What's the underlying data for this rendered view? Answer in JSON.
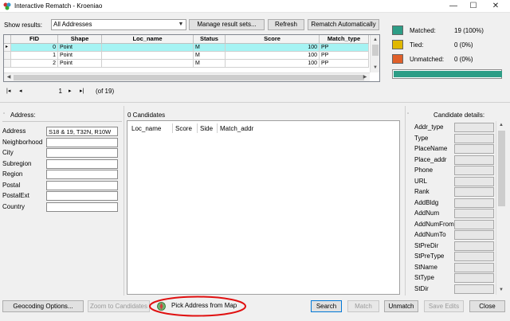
{
  "window": {
    "title": "Interactive Rematch - Kroeniao",
    "minimize": "—",
    "maximize": "☐",
    "close": "✕"
  },
  "toolbar": {
    "show_results_label": "Show results:",
    "show_results_value": "All Addresses",
    "manage_label": "Manage result sets...",
    "refresh_label": "Refresh",
    "rematch_auto_label": "Rematch Automatically"
  },
  "grid": {
    "columns": [
      "FID",
      "Shape",
      "Loc_name",
      "Status",
      "Score",
      "Match_type"
    ],
    "rows": [
      {
        "fid": "0",
        "shape": "Point",
        "loc_name": "",
        "status": "M",
        "score": "100",
        "match_type": "PP",
        "marker": "▸"
      },
      {
        "fid": "1",
        "shape": "Point",
        "loc_name": "",
        "status": "M",
        "score": "100",
        "match_type": "PP",
        "marker": ""
      },
      {
        "fid": "2",
        "shape": "Point",
        "loc_name": "",
        "status": "M",
        "score": "100",
        "match_type": "PP",
        "marker": ""
      }
    ]
  },
  "nav": {
    "first": "|◂",
    "prev": "◂",
    "current": "1",
    "next": "▸",
    "last": "▸|",
    "of_text": "(of 19)"
  },
  "stats": [
    {
      "label": "Matched:",
      "value": "19 (100%)",
      "color": "#2d9d86"
    },
    {
      "label": "Tied:",
      "value": "0 (0%)",
      "color": "#e0b800"
    },
    {
      "label": "Unmatched:",
      "value": "0 (0%)",
      "color": "#e0602a"
    }
  ],
  "progress": {
    "fraction": 1.0,
    "color": "#2d9d86"
  },
  "address": {
    "header": "Address:",
    "fields": [
      {
        "label": "Address",
        "value": "S18 & 19, T32N, R10W"
      },
      {
        "label": "Neighborhood",
        "value": ""
      },
      {
        "label": "City",
        "value": ""
      },
      {
        "label": "Subregion",
        "value": ""
      },
      {
        "label": "Region",
        "value": ""
      },
      {
        "label": "Postal",
        "value": ""
      },
      {
        "label": "PostalExt",
        "value": ""
      },
      {
        "label": "Country",
        "value": ""
      }
    ]
  },
  "candidates": {
    "header": "0 Candidates",
    "columns": [
      "Loc_name",
      "Score",
      "Side",
      "Match_addr"
    ]
  },
  "details": {
    "header": "Candidate details:",
    "fields": [
      "Addr_type",
      "Type",
      "PlaceName",
      "Place_addr",
      "Phone",
      "URL",
      "Rank",
      "AddBldg",
      "AddNum",
      "AddNumFrom",
      "AddNumTo",
      "StPreDir",
      "StPreType",
      "StName",
      "StType",
      "StDir"
    ]
  },
  "bottom": {
    "geocoding_options": "Geocoding Options...",
    "zoom_to_candidates": "Zoom to Candidates",
    "pick_address": "Pick Address from Map",
    "search": "Search",
    "match": "Match",
    "unmatch": "Unmatch",
    "save_edits": "Save Edits",
    "close": "Close"
  }
}
